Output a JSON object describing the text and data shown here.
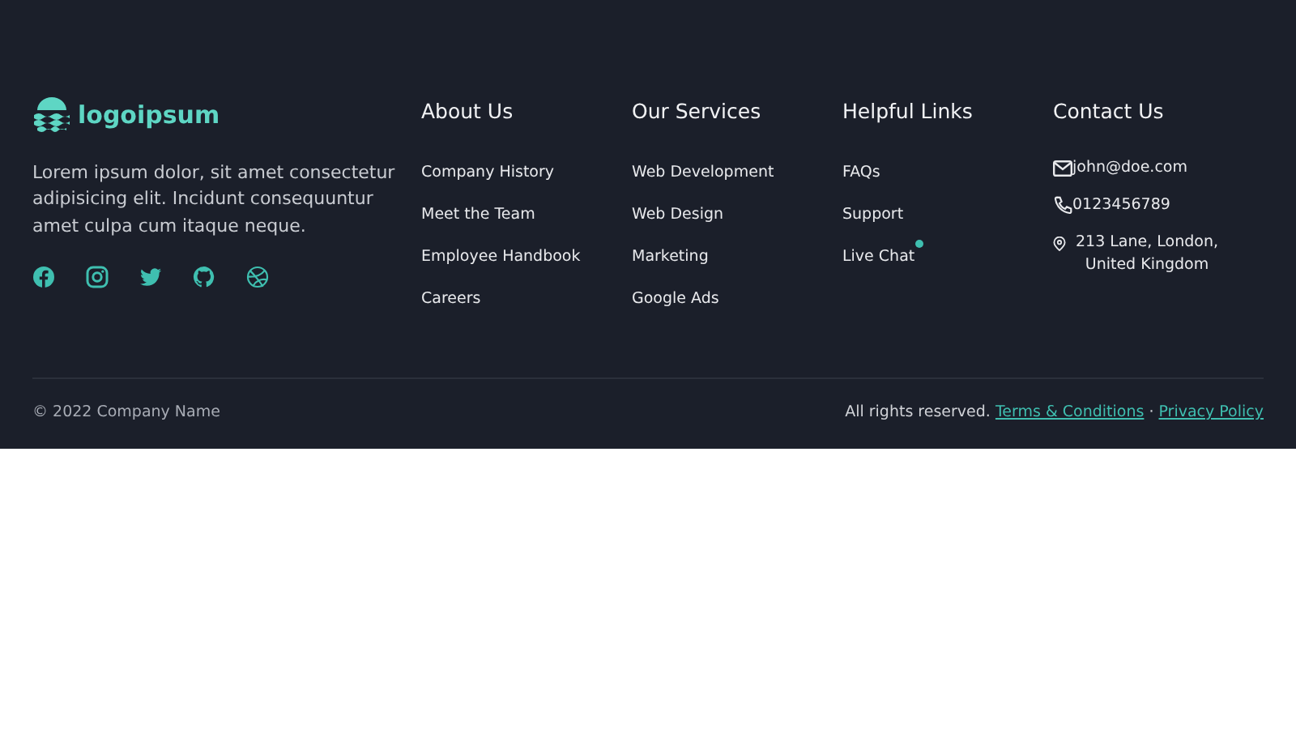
{
  "brand": {
    "name": "logoipsum",
    "description": "Lorem ipsum dolor, sit amet consectetur adipisicing elit. Incidunt consequuntur amet culpa cum itaque neque."
  },
  "social": [
    {
      "kind": "facebook"
    },
    {
      "kind": "instagram"
    },
    {
      "kind": "twitter"
    },
    {
      "kind": "github"
    },
    {
      "kind": "dribbble"
    }
  ],
  "columns": [
    {
      "title": "About Us",
      "links": [
        {
          "label": "Company History",
          "indicator": false
        },
        {
          "label": "Meet the Team",
          "indicator": false
        },
        {
          "label": "Employee Handbook",
          "indicator": false
        },
        {
          "label": "Careers",
          "indicator": false
        }
      ]
    },
    {
      "title": "Our Services",
      "links": [
        {
          "label": "Web Development",
          "indicator": false
        },
        {
          "label": "Web Design",
          "indicator": false
        },
        {
          "label": "Marketing",
          "indicator": false
        },
        {
          "label": "Google Ads",
          "indicator": false
        }
      ]
    },
    {
      "title": "Helpful Links",
      "links": [
        {
          "label": "FAQs",
          "indicator": false
        },
        {
          "label": "Support",
          "indicator": false
        },
        {
          "label": "Live Chat",
          "indicator": true
        }
      ]
    }
  ],
  "contact": {
    "title": "Contact Us",
    "items": [
      {
        "kind": "email",
        "text": "john@doe.com"
      },
      {
        "kind": "phone",
        "text": "0123456789"
      },
      {
        "kind": "address",
        "text": "213 Lane, London, United Kingdom"
      }
    ]
  },
  "bottom": {
    "copyright": "© 2022 Company Name",
    "rights": "All rights reserved.",
    "links": [
      "Terms & Conditions",
      "Privacy Policy"
    ],
    "separator": "·"
  }
}
